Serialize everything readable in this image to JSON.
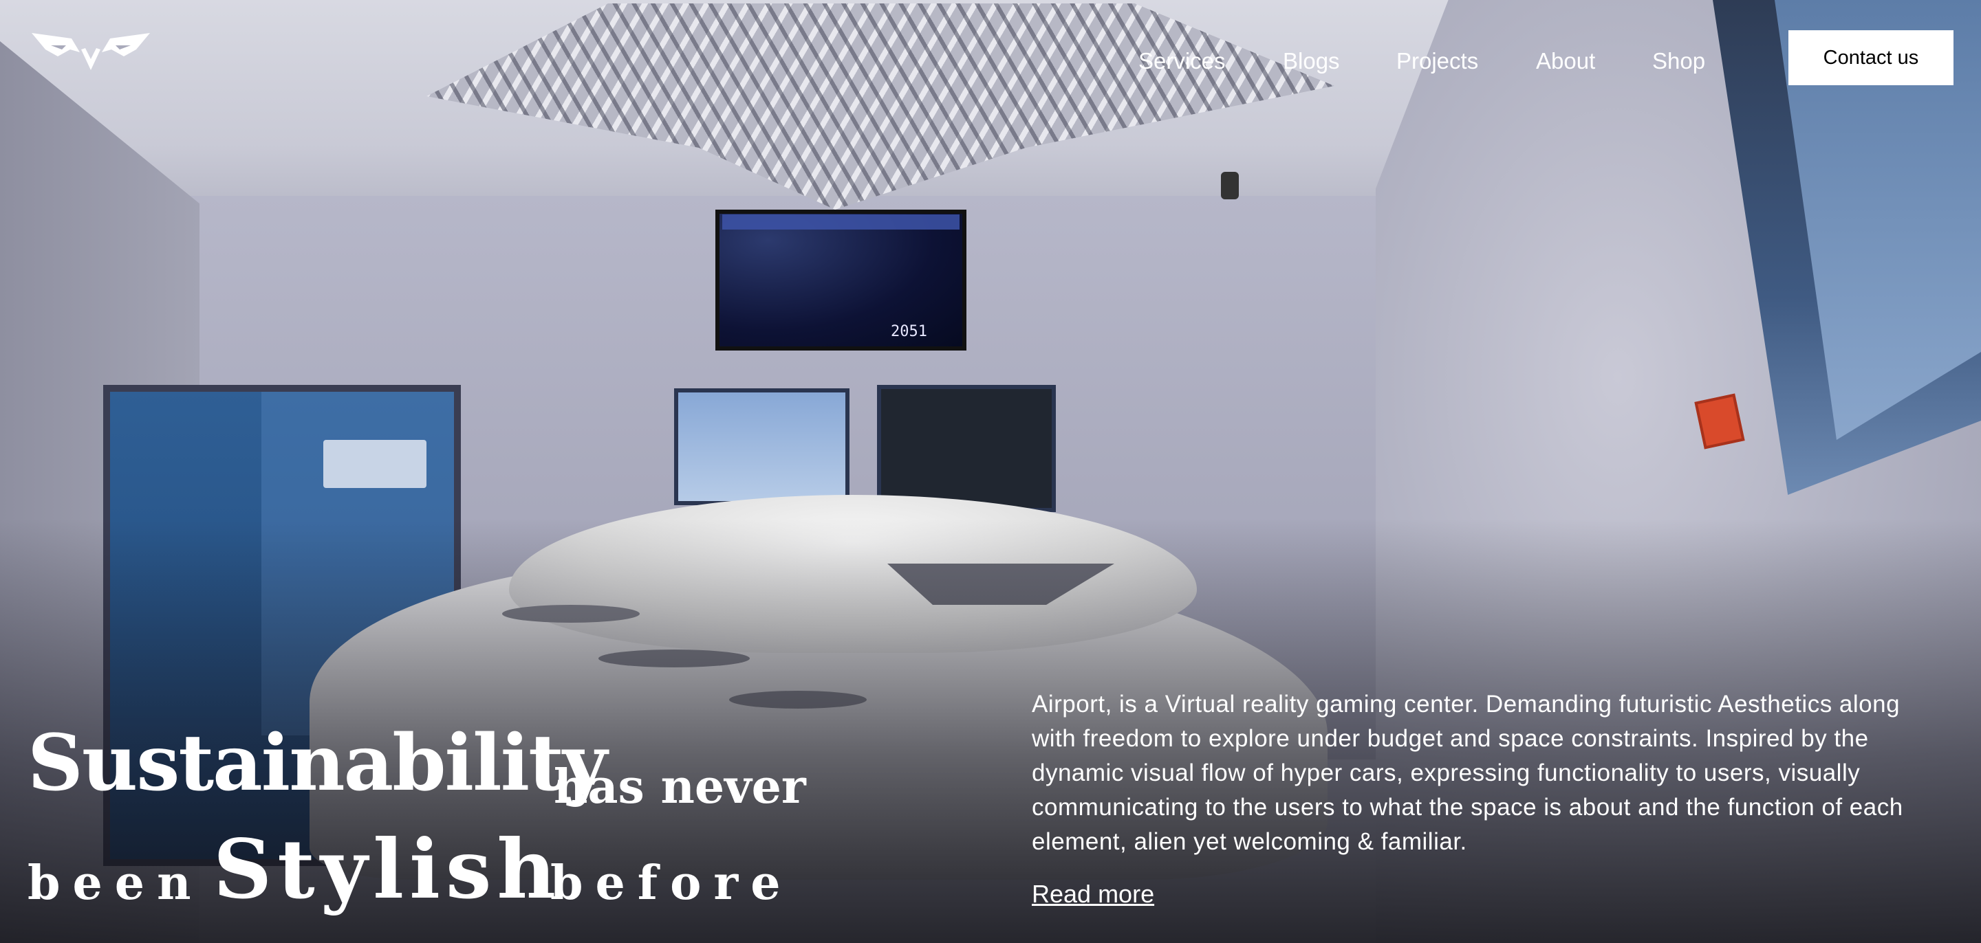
{
  "header": {
    "nav": [
      "Services",
      "Blogs",
      "Projects",
      "About",
      "Shop"
    ],
    "contact_label": "Contact us"
  },
  "hero": {
    "tv_readout": "2051",
    "headline": {
      "word1": "Sustainability",
      "word2": "has never",
      "word3": "been",
      "word4": "Stylish",
      "word5": "before"
    },
    "description": "Airport, is a Virtual reality gaming center.  Demanding futuristic Aesthetics along with freedom to explore under budget and space constraints. Inspired by the dynamic visual flow of hyper cars, expressing functionality to users, visually communicating to the users to what the space is about and the function of each element, alien yet welcoming & familiar.",
    "read_more": "Read more"
  },
  "icons": {
    "logo": "winged-logo-icon"
  },
  "colors": {
    "text": "#ffffff",
    "button_bg": "#ffffff",
    "button_text": "#000000"
  }
}
